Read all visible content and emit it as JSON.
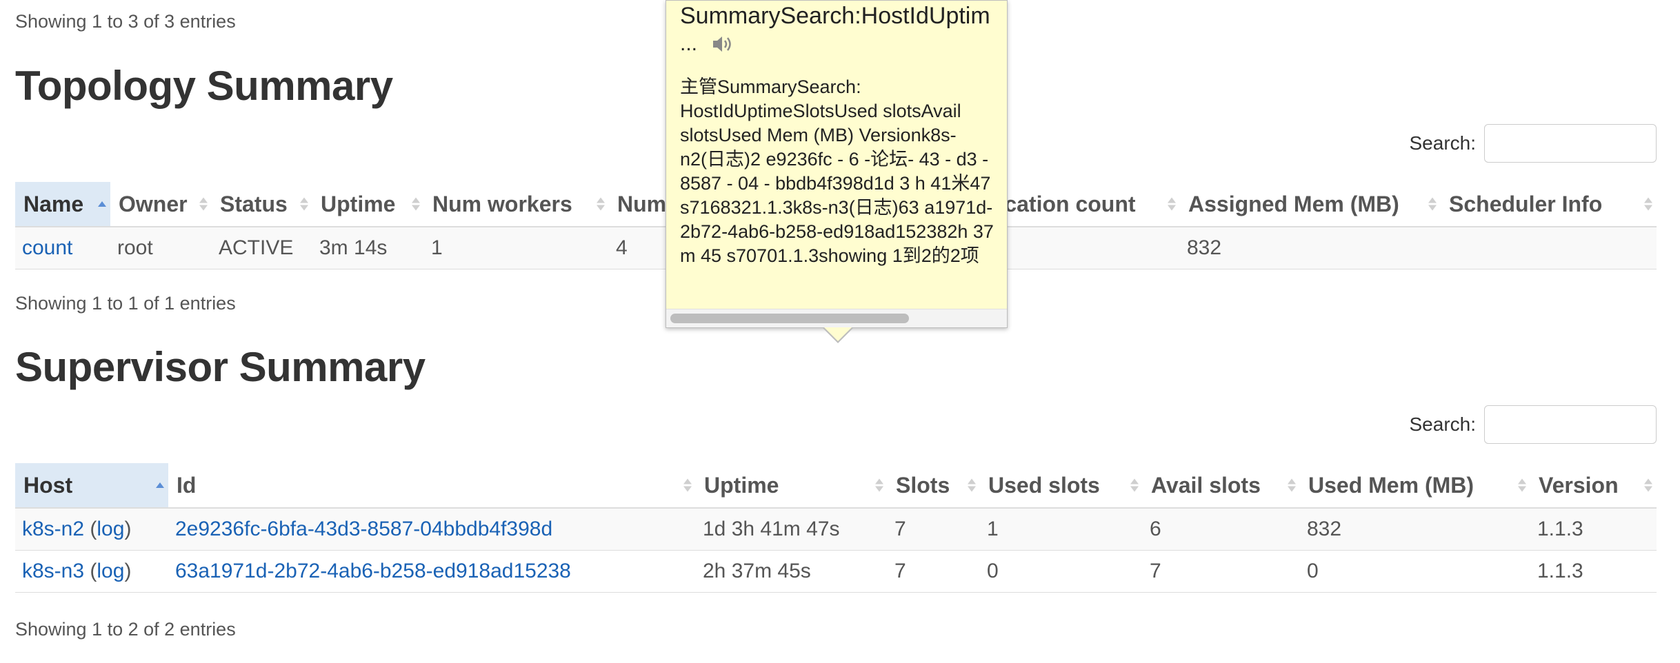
{
  "top_info": "Showing 1 to 3 of 3 entries",
  "topology": {
    "title": "Topology Summary",
    "search_label": "Search:",
    "columns": [
      "Name",
      "Owner",
      "Status",
      "Uptime",
      "Num workers",
      "Num",
      "plication count",
      "Assigned Mem (MB)",
      "Scheduler Info"
    ],
    "rows": [
      {
        "name": "count",
        "owner": "root",
        "status": "ACTIVE",
        "uptime": "3m 14s",
        "workers": "1",
        "num": "4",
        "replication": "",
        "assigned_mem": "832",
        "scheduler_info": ""
      }
    ],
    "info": "Showing 1 to 1 of 1 entries"
  },
  "supervisor": {
    "title": "Supervisor Summary",
    "search_label": "Search:",
    "columns": [
      "Host",
      "Id",
      "Uptime",
      "Slots",
      "Used slots",
      "Avail slots",
      "Used Mem (MB)",
      "Version"
    ],
    "rows": [
      {
        "host": "k8s-n2",
        "log": "log",
        "id": "2e9236fc-6bfa-43d3-8587-04bbdb4f398d",
        "uptime": "1d 3h 41m 47s",
        "slots": "7",
        "used_slots": "1",
        "avail_slots": "6",
        "used_mem": "832",
        "version": "1.1.3"
      },
      {
        "host": "k8s-n3",
        "log": "log",
        "id": "63a1971d-2b72-4ab6-b258-ed918ad15238",
        "uptime": "2h 37m 45s",
        "slots": "7",
        "used_slots": "0",
        "avail_slots": "7",
        "used_mem": "0",
        "version": "1.1.3"
      }
    ],
    "info": "Showing 1 to 2 of 2 entries"
  },
  "popup": {
    "title": "SummarySearch:HostIdUptim",
    "ellipsis": "...",
    "speaker_icon": "speaker-icon",
    "body": "主管SummarySearch: HostIdUptimeSlotsUsed slotsAvail slotsUsed Mem (MB) Versionk8s-n2(日志)2 e9236fc - 6 -论坛- 43 - d3 - 8587 - 04 - bbdb4f398d1d 3 h 41米47 s7168321.1.3k8s-n3(日志)63 a1971d-2b72-4ab6-b258-ed918ad152382h 37 m 45 s70701.1.3showing 1到2的2项"
  },
  "colors": {
    "link": "#1a62b5",
    "sorted_header_bg": "#dde9f5",
    "popup_bg": "#fffdd0",
    "row_stripe": "#f9f9f9"
  }
}
